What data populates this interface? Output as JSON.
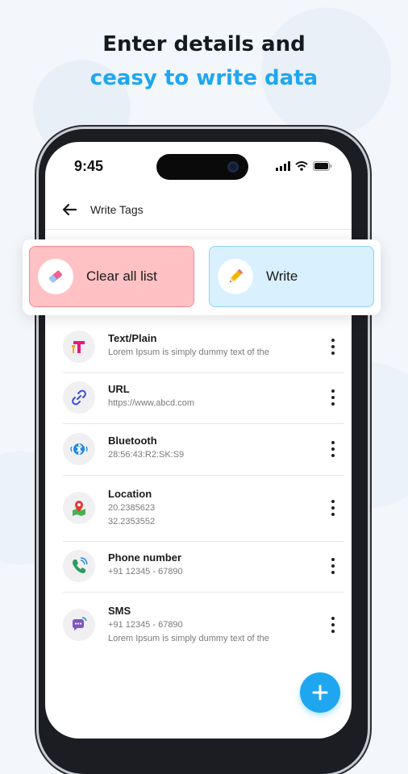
{
  "promo": {
    "line1": "Enter details and",
    "line2": "ceasy to write data"
  },
  "status_bar": {
    "time": "9:45"
  },
  "appbar": {
    "title": "Write Tags"
  },
  "actions": {
    "clear_label": "Clear all list",
    "write_label": "Write"
  },
  "items": [
    {
      "title": "Text/Plain",
      "lines": [
        "Lorem Ipsum is simply dummy text of the"
      ],
      "icon": "text-t-icon"
    },
    {
      "title": "URL",
      "lines": [
        "https://www.abcd.com"
      ],
      "icon": "link-icon"
    },
    {
      "title": "Bluetooth",
      "lines": [
        "28:56:43:R2:SK:S9"
      ],
      "icon": "bluetooth-icon"
    },
    {
      "title": "Location",
      "lines": [
        "20.2385623",
        "32.2353552"
      ],
      "icon": "map-pin-icon"
    },
    {
      "title": "Phone number",
      "lines": [
        "+91 12345 - 67890"
      ],
      "icon": "phone-icon"
    },
    {
      "title": "SMS",
      "lines": [
        "+91 12345 - 67890",
        "Lorem Ipsum is simply dummy text of the"
      ],
      "icon": "sms-icon"
    }
  ],
  "colors": {
    "accent": "#1ea7f0",
    "clear_bg": "#ffc1c4",
    "write_bg": "#d8f0ff"
  }
}
